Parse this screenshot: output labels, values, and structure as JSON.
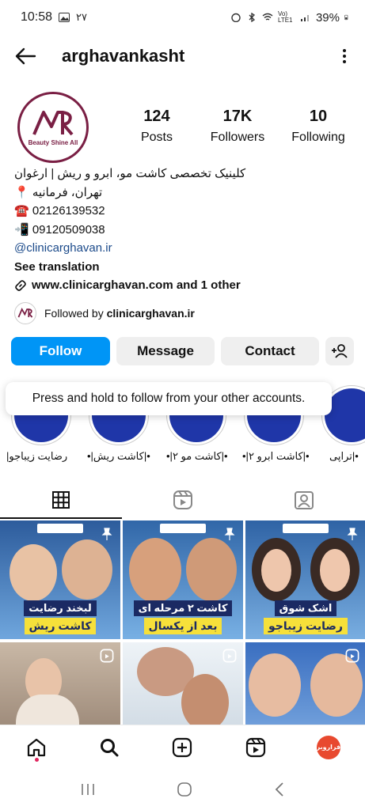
{
  "status_bar": {
    "time": "10:58",
    "extra": "۲۷",
    "network": "Vo) LTE1",
    "battery": "39%"
  },
  "header": {
    "username": "arghavankasht"
  },
  "profile": {
    "avatar_text": "Beauty Shine All",
    "stats": [
      {
        "value": "124",
        "label": "Posts"
      },
      {
        "value": "17K",
        "label": "Followers"
      },
      {
        "value": "10",
        "label": "Following"
      }
    ],
    "bio_lines": [
      "کلینیک تخصصی کاشت مو، ابرو و ریش | ارغوان",
      "تهران، فرمانیه 📍",
      "☎️ 02126139532",
      "📲 09120509038"
    ],
    "mention": "@clinicarghavan.ir",
    "see_translation": "See translation",
    "website": "www.clinicarghavan.com and 1 other",
    "followed_by_prefix": "Followed by ",
    "followed_by_name": "clinicarghavan.ir"
  },
  "actions": {
    "follow": "Follow",
    "message": "Message",
    "contact": "Contact"
  },
  "tooltip": "Press and hold to follow from your other accounts.",
  "highlights": [
    {
      "label": "رضایت زیباجو|"
    },
    {
      "label": "•|کاشت ریش|•"
    },
    {
      "label": "•|کاشت مو ۲|•"
    },
    {
      "label": "•|کاشت ابرو ۲|•"
    },
    {
      "label": "•|تراپی"
    }
  ],
  "posts": [
    {
      "line1": "لبخند رضایت",
      "line2": "کاشت ریش",
      "pinned": true
    },
    {
      "line1": "کاشت ۲ مرحله ای",
      "line2": "بعد از یکسال",
      "pinned": true
    },
    {
      "line1": "اشک شوق",
      "line2": "رضایت زیباجو",
      "pinned": true
    },
    {
      "line1": "",
      "line2": "",
      "pinned": false
    },
    {
      "line1": "",
      "line2": "",
      "pinned": false
    },
    {
      "line1": "",
      "line2": "",
      "pinned": false
    }
  ],
  "bottom_nav": {
    "profile_label": "فراروبر"
  },
  "colors": {
    "follow_blue": "#0095f6",
    "brand_maroon": "#7a1f44",
    "highlight_blue": "#1f36a8",
    "banner_yellow": "#f6e03a"
  }
}
